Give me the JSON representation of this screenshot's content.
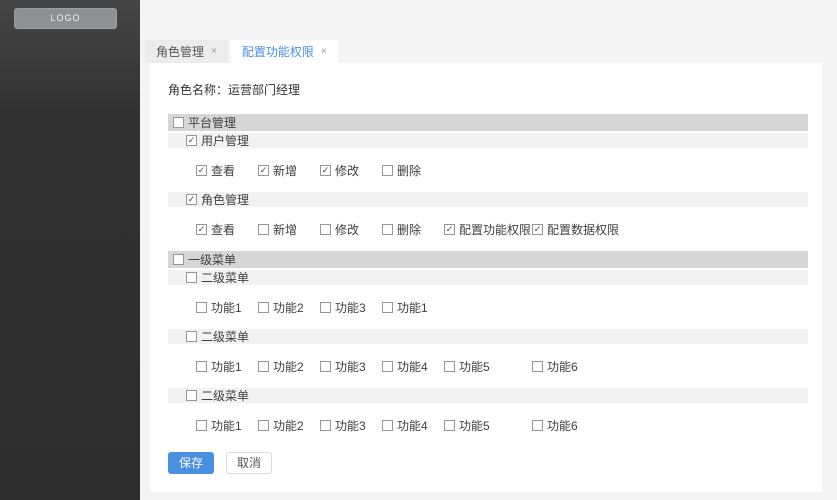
{
  "sidebar": {
    "logo_label": "LOGO"
  },
  "tabs": [
    {
      "label": "角色管理",
      "close": "×",
      "active": false
    },
    {
      "label": "配置功能权限",
      "close": "×",
      "active": true
    }
  ],
  "role": {
    "label": "角色名称：",
    "value": "运营部门经理"
  },
  "tree": [
    {
      "label": "平台管理",
      "checked": false,
      "children": [
        {
          "label": "用户管理",
          "checked": true,
          "items": [
            {
              "label": "查看",
              "checked": true
            },
            {
              "label": "新增",
              "checked": true
            },
            {
              "label": "修改",
              "checked": true
            },
            {
              "label": "删除",
              "checked": false
            }
          ]
        },
        {
          "label": "角色管理",
          "checked": true,
          "items": [
            {
              "label": "查看",
              "checked": true
            },
            {
              "label": "新增",
              "checked": false
            },
            {
              "label": "修改",
              "checked": false
            },
            {
              "label": "删除",
              "checked": false
            },
            {
              "label": "配置功能权限",
              "checked": true
            },
            {
              "label": "配置数据权限",
              "checked": true
            }
          ]
        }
      ]
    },
    {
      "label": "一级菜单",
      "checked": false,
      "children": [
        {
          "label": "二级菜单",
          "checked": false,
          "items": [
            {
              "label": "功能1",
              "checked": false
            },
            {
              "label": "功能2",
              "checked": false
            },
            {
              "label": "功能3",
              "checked": false
            },
            {
              "label": "功能1",
              "checked": false
            }
          ]
        },
        {
          "label": "二级菜单",
          "checked": false,
          "items": [
            {
              "label": "功能1",
              "checked": false
            },
            {
              "label": "功能2",
              "checked": false
            },
            {
              "label": "功能3",
              "checked": false
            },
            {
              "label": "功能4",
              "checked": false
            },
            {
              "label": "功能5",
              "checked": false
            },
            {
              "label": "功能6",
              "checked": false
            }
          ]
        },
        {
          "label": "二级菜单",
          "checked": false,
          "items": [
            {
              "label": "功能1",
              "checked": false
            },
            {
              "label": "功能2",
              "checked": false
            },
            {
              "label": "功能3",
              "checked": false
            },
            {
              "label": "功能4",
              "checked": false
            },
            {
              "label": "功能5",
              "checked": false
            },
            {
              "label": "功能6",
              "checked": false
            }
          ]
        }
      ]
    }
  ],
  "actions": {
    "save": "保存",
    "cancel": "取消"
  },
  "colors": {
    "accent": "#4a90e2",
    "sidebar_bg": "#323232",
    "level1_bar": "#d6d6d6",
    "level2_bar": "#f2f2f2",
    "page_bg": "#f4f4f5"
  }
}
